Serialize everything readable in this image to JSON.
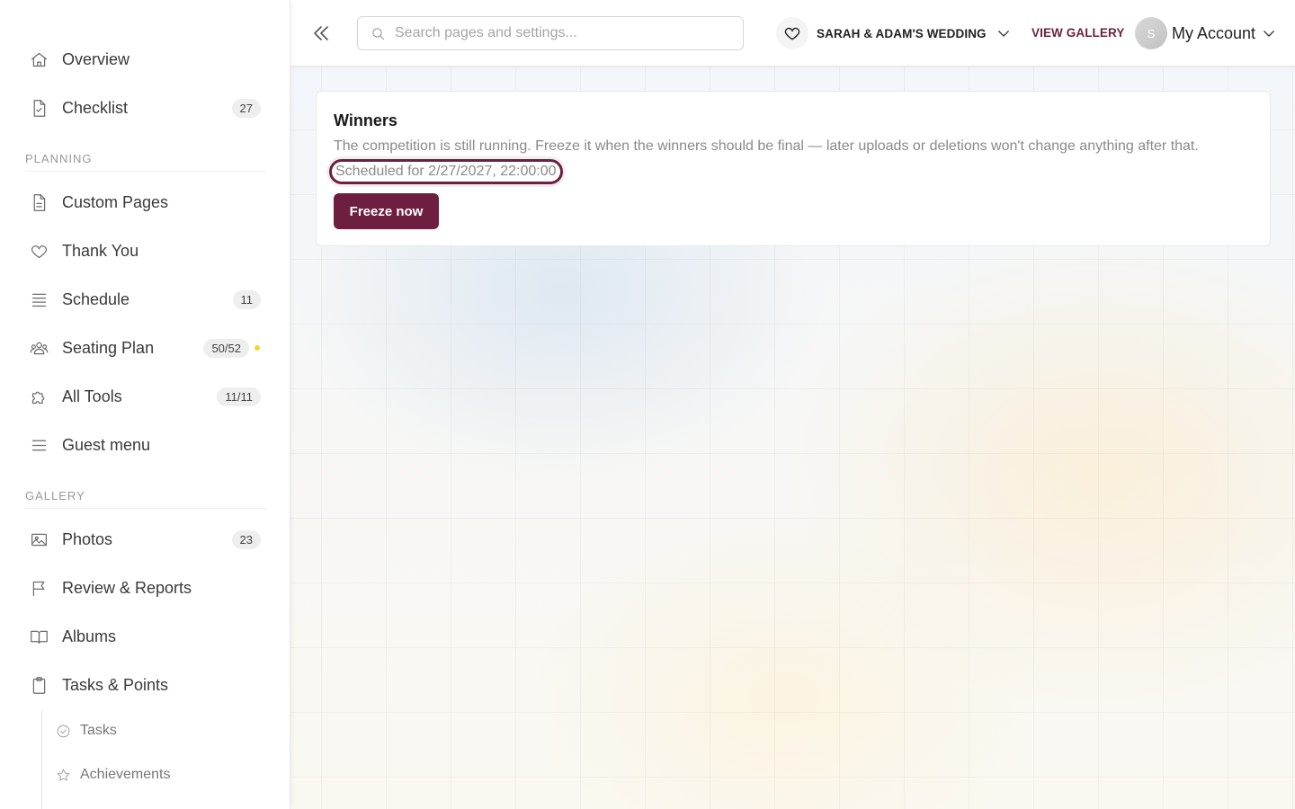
{
  "sidebar": {
    "top_items": [
      {
        "label": "Overview",
        "icon": "home-icon"
      },
      {
        "label": "Checklist",
        "icon": "checklist-icon",
        "badge": "27"
      }
    ],
    "planning": {
      "heading": "PLANNING",
      "items": [
        {
          "label": "Custom Pages",
          "icon": "document-icon"
        },
        {
          "label": "Thank You",
          "icon": "heart-icon"
        },
        {
          "label": "Schedule",
          "icon": "list-icon",
          "badge": "11"
        },
        {
          "label": "Seating Plan",
          "icon": "people-icon",
          "badge": "50/52",
          "indicator_color": "#f6d629"
        },
        {
          "label": "All Tools",
          "icon": "puzzle-icon",
          "badge": "11/11"
        },
        {
          "label": "Guest menu",
          "icon": "menu-icon"
        }
      ]
    },
    "gallery": {
      "heading": "GALLERY",
      "items": [
        {
          "label": "Photos",
          "icon": "image-icon",
          "badge": "23"
        },
        {
          "label": "Review & Reports",
          "icon": "flag-icon"
        },
        {
          "label": "Albums",
          "icon": "book-icon"
        },
        {
          "label": "Tasks & Points",
          "icon": "clipboard-icon"
        }
      ],
      "sub_items": [
        {
          "label": "Tasks",
          "icon": "check-circle-icon"
        },
        {
          "label": "Achievements",
          "icon": "star-icon"
        }
      ]
    }
  },
  "topbar": {
    "search_placeholder": "Search pages and settings...",
    "event_name": "SARAH & ADAM'S WEDDING",
    "view_gallery": "VIEW GALLERY",
    "avatar_initial": "S",
    "account_label": "My Account"
  },
  "winners_card": {
    "title": "Winners",
    "description": "The competition is still running. Freeze it when the winners should be final — later uploads or deletions won't change anything after that.",
    "scheduled": "Scheduled for 2/27/2027, 22:00:00",
    "freeze_button": "Freeze now"
  },
  "colors": {
    "accent": "#6e1f3f",
    "indicator": "#f6d629"
  }
}
